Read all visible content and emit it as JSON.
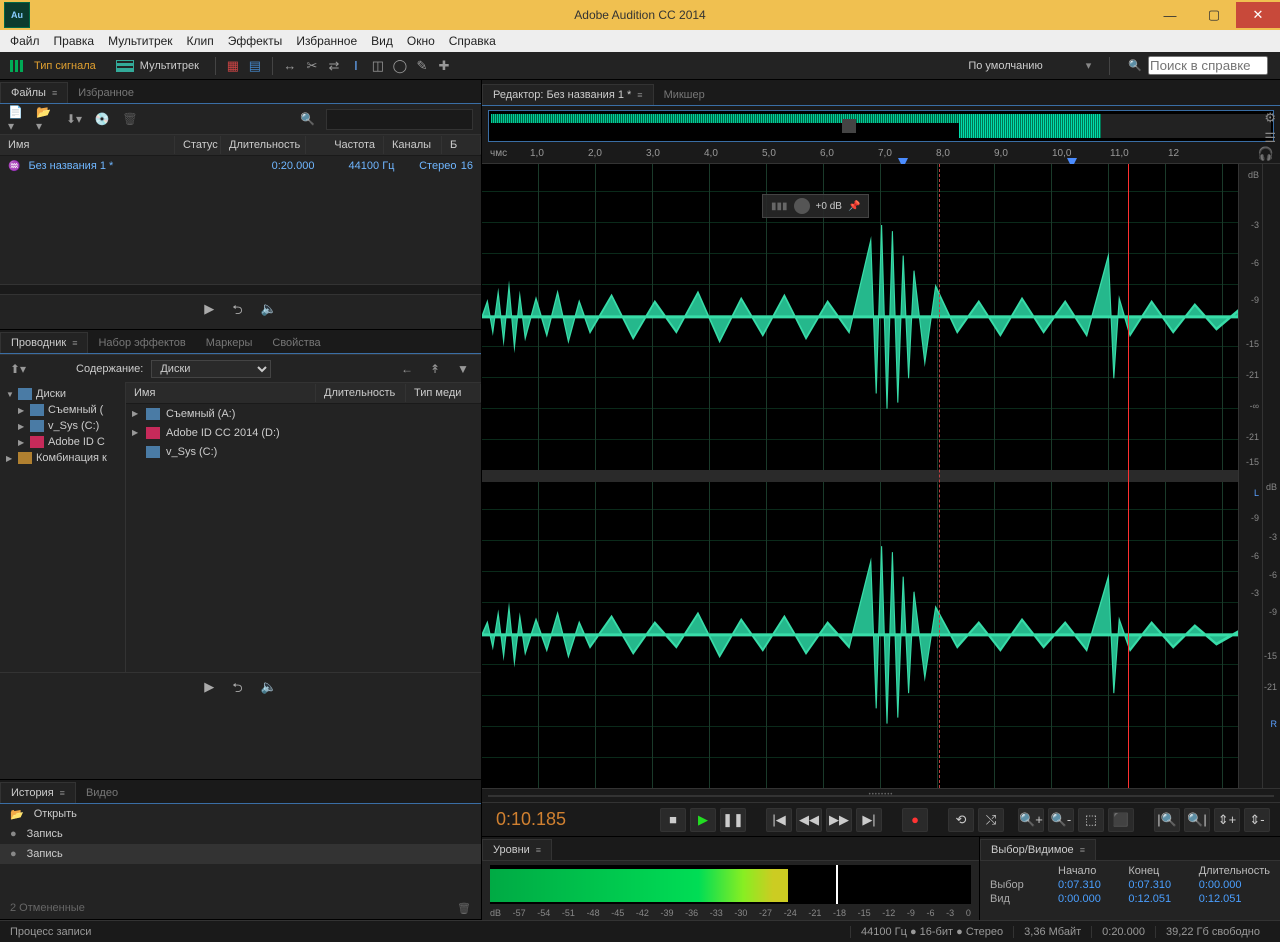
{
  "titlebar": {
    "title": "Adobe Audition CC 2014",
    "app_icon": "Au"
  },
  "menubar": [
    "Файл",
    "Правка",
    "Мультитрек",
    "Клип",
    "Эффекты",
    "Избранное",
    "Вид",
    "Окно",
    "Справка"
  ],
  "toolbar": {
    "mode_waveform": "Тип сигнала",
    "mode_multitrack": "Мультитрек",
    "workspace": "По умолчанию",
    "search_placeholder": "Поиск в справке"
  },
  "files": {
    "tab": "Файлы",
    "tab2": "Избранное",
    "columns": [
      "Имя",
      "Статус",
      "Длительность",
      "Частота",
      "Каналы",
      "Б"
    ],
    "rows": [
      {
        "name": "Без названия 1 *",
        "status": "",
        "duration": "0:20.000",
        "rate": "44100 Гц",
        "channels": "Стерео",
        "bits": "16"
      }
    ]
  },
  "browser": {
    "tabs": [
      "Проводник",
      "Набор эффектов",
      "Маркеры",
      "Свойства"
    ],
    "content_label": "Содержание:",
    "content_value": "Диски",
    "tree": [
      {
        "label": "Диски",
        "type": "root"
      },
      {
        "label": "Съемный (",
        "type": "drive",
        "indent": 1
      },
      {
        "label": "v_Sys (C:)",
        "type": "drive",
        "indent": 1
      },
      {
        "label": "Adobe ID C",
        "type": "id",
        "indent": 1
      },
      {
        "label": "Комбинация к",
        "type": "folder",
        "indent": 0
      }
    ],
    "list_columns": [
      "Имя",
      "Длительность",
      "Тип меди"
    ],
    "list": [
      {
        "name": "Съемный (A:)",
        "type": "drive"
      },
      {
        "name": "Adobe ID CC 2014 (D:)",
        "type": "id"
      },
      {
        "name": "v_Sys (C:)",
        "type": "drive"
      }
    ]
  },
  "history": {
    "tabs": [
      "История",
      "Видео"
    ],
    "items": [
      "Открыть",
      "Запись",
      "Запись"
    ],
    "footer": "2 Отмененные"
  },
  "editor": {
    "tab": "Редактор: Без названия 1 *",
    "tab2": "Микшер",
    "hud_gain": "+0 dB",
    "ruler_unit": "чмс",
    "ruler_ticks": [
      "1,0",
      "2,0",
      "3,0",
      "4,0",
      "5,0",
      "6,0",
      "7,0",
      "8,0",
      "9,0",
      "10,0",
      "11,0",
      "12"
    ],
    "db_marks": [
      "dB",
      "-3",
      "-6",
      "-9",
      "-15",
      "-21",
      "∞",
      "-21",
      "-15",
      "-9",
      "-6",
      "-3"
    ],
    "channels": [
      "L",
      "R"
    ],
    "playhead_pct": 85.5,
    "sel_line_pct": 72.8,
    "marker1_pct": 60.5,
    "marker2_pct": 85.5
  },
  "transport": {
    "timecode": "0:10.185",
    "buttons": [
      "stop",
      "play",
      "pause",
      "skip-start",
      "rewind",
      "ffwd",
      "skip-end",
      "record",
      "loop",
      "punch"
    ],
    "zoom_buttons": [
      "zoom-in",
      "zoom-out",
      "zoom-full",
      "zoom-sel",
      "zoom-in-v",
      "zoom-out-v",
      "zoom-in-sel",
      "zoom-out-sel"
    ]
  },
  "levels": {
    "title": "Уровни",
    "scale": [
      "dB",
      "-57",
      "-54",
      "-51",
      "-48",
      "-45",
      "-42",
      "-39",
      "-36",
      "-33",
      "-30",
      "-27",
      "-24",
      "-21",
      "-18",
      "-15",
      "-12",
      "-9",
      "-6",
      "-3",
      "0"
    ]
  },
  "selection_panel": {
    "title": "Выбор/Видимое",
    "headers": [
      "Начало",
      "Конец",
      "Длительность"
    ],
    "rows": [
      {
        "label": "Выбор",
        "start": "0:07.310",
        "end": "0:07.310",
        "dur": "0:00.000"
      },
      {
        "label": "Вид",
        "start": "0:00.000",
        "end": "0:12.051",
        "dur": "0:12.051"
      }
    ]
  },
  "statusbar": {
    "process": "Процесс записи",
    "rate": "44100 Гц",
    "bits": "16-бит",
    "channels": "Стерео",
    "size": "3,36 Мбайт",
    "duration": "0:20.000",
    "free": "39,22 Гб свободно"
  }
}
